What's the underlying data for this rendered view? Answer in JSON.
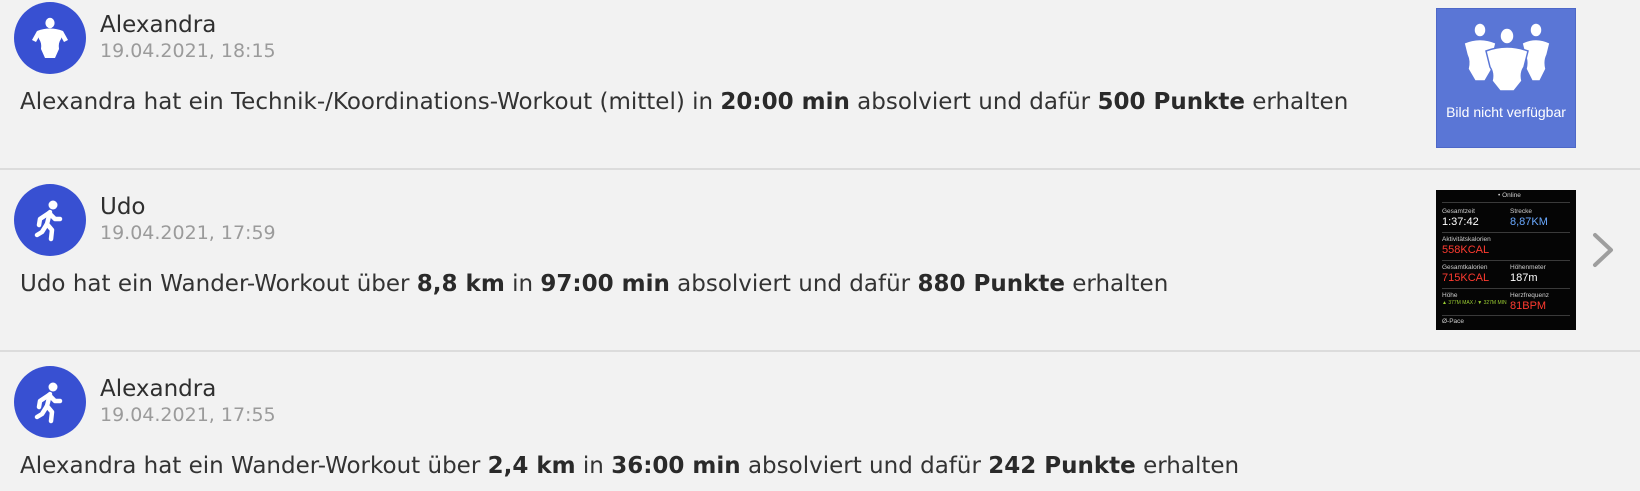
{
  "feed": {
    "items": [
      {
        "name": "Alexandra",
        "timestamp": "19.04.2021, 18:15",
        "avatar_icon": "group-person-icon",
        "text_pre": "Alexandra hat ein Technik-/Koordinations-Workout (mittel)  in ",
        "duration": "20:00 min",
        "text_mid": " absolviert und dafür ",
        "points": "500 Punkte",
        "text_post": " erhalten",
        "image_placeholder": "Bild nicht verfügbar"
      },
      {
        "name": "Udo",
        "timestamp": "19.04.2021, 17:59",
        "avatar_icon": "walking-person-icon",
        "text_pre": "Udo hat ein Wander-Workout über ",
        "distance": "8,8 km",
        "text_in": " in ",
        "duration": "97:00 min",
        "text_mid": " absolviert und dafür ",
        "points": "880 Punkte",
        "text_post": " erhalten",
        "screenshot": {
          "top_label": "• Online",
          "gesamtzeit_label": "Gesamtzeit",
          "gesamtzeit_value": "1:37:42",
          "strecke_label": "Strecke",
          "strecke_value": "8,87KM",
          "aktiv_label": "Aktivitätskalorien",
          "aktiv_value": "558KCAL",
          "gesamt_label": "Gesamtkalorien",
          "gesamt_value": "715KCAL",
          "hoehe_label": "Höhenmeter",
          "hoehe_value": "187m",
          "herz_label": "Herzfrequenz",
          "herz_value": "81BPM",
          "hoehe2_label": "Höhe",
          "hoehe2_values": "▲ 377M MAX / ▼ 327M MIN",
          "pace_label": "Ø-Pace"
        },
        "has_chevron": true
      },
      {
        "name": "Alexandra",
        "timestamp": "19.04.2021, 17:55",
        "avatar_icon": "walking-person-icon",
        "text_pre": "Alexandra hat ein Wander-Workout über ",
        "distance": "2,4 km",
        "text_in": " in ",
        "duration": "36:00 min",
        "text_mid": " absolviert und dafür ",
        "points": "242 Punkte",
        "text_post": " erhalten"
      }
    ]
  },
  "colors": {
    "avatar_bg": "#3850d2",
    "placeholder_bg": "#5a76d6",
    "red_value": "#ff3b30",
    "blue_value": "#6aa9ff"
  }
}
